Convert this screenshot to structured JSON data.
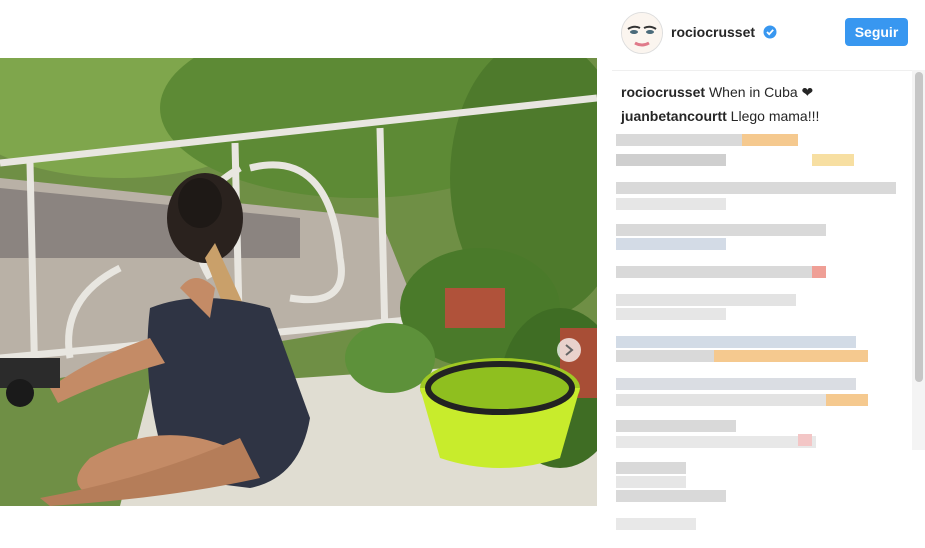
{
  "post": {
    "username": "rociocrusset",
    "follow_label": "Seguir",
    "next_icon": "chevron-right-icon",
    "verified_icon": "verified-badge-icon"
  },
  "comments": [
    {
      "user": "rociocrusset",
      "text": "When in Cuba ❤"
    },
    {
      "user": "juanbetancourtt",
      "text": "Llego mama!!!"
    }
  ],
  "colors": {
    "accent": "#3897f0",
    "verified": "#3897f0",
    "bucket": "#c8ec2c",
    "foliage": "#5a8a38"
  }
}
